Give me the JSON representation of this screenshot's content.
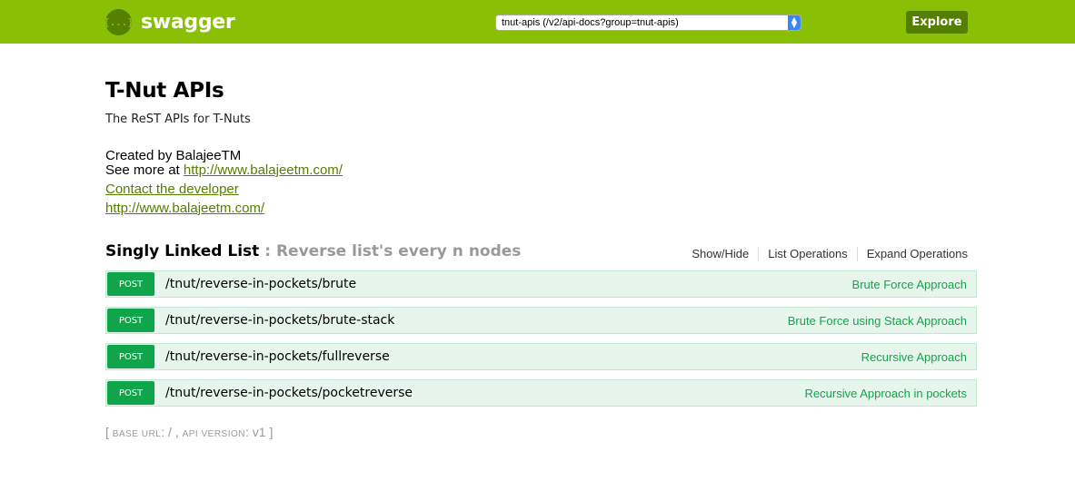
{
  "header": {
    "logo_icon": "{...}",
    "logo_text": "swagger",
    "url_value": "tnut-apis (/v2/api-docs?group=tnut-apis)",
    "explore_label": "Explore"
  },
  "info": {
    "title": "T-Nut APIs",
    "description": "The ReST APIs for T-Nuts",
    "created_by": "Created by BalajeeTM",
    "see_more_prefix": "See more at ",
    "see_more_link": "http://www.balajeetm.com/",
    "contact_link": "Contact the developer",
    "license_link": "http://www.balajeetm.com/"
  },
  "resource": {
    "name": "Singly Linked List",
    "separator": " : ",
    "description": "Reverse list's every n nodes",
    "actions": [
      "Show/Hide",
      "List Operations",
      "Expand Operations"
    ]
  },
  "operations": [
    {
      "method": "POST",
      "path": "/tnut/reverse-in-pockets/brute",
      "summary": "Brute Force Approach"
    },
    {
      "method": "POST",
      "path": "/tnut/reverse-in-pockets/brute-stack",
      "summary": "Brute Force using Stack Approach"
    },
    {
      "method": "POST",
      "path": "/tnut/reverse-in-pockets/fullreverse",
      "summary": "Recursive Approach"
    },
    {
      "method": "POST",
      "path": "/tnut/reverse-in-pockets/pocketreverse",
      "summary": "Recursive Approach in pockets"
    }
  ],
  "footer": {
    "open": "[ ",
    "base_url_label": "BASE URL",
    "base_url_value": ": / , ",
    "api_version_label": "API VERSION",
    "api_version_value": ": v1 ",
    "close": "]"
  },
  "colors": {
    "header_bg": "#89bf04",
    "accent": "#547f00",
    "post": "#10a54a",
    "op_bg": "#e7f6ec"
  }
}
